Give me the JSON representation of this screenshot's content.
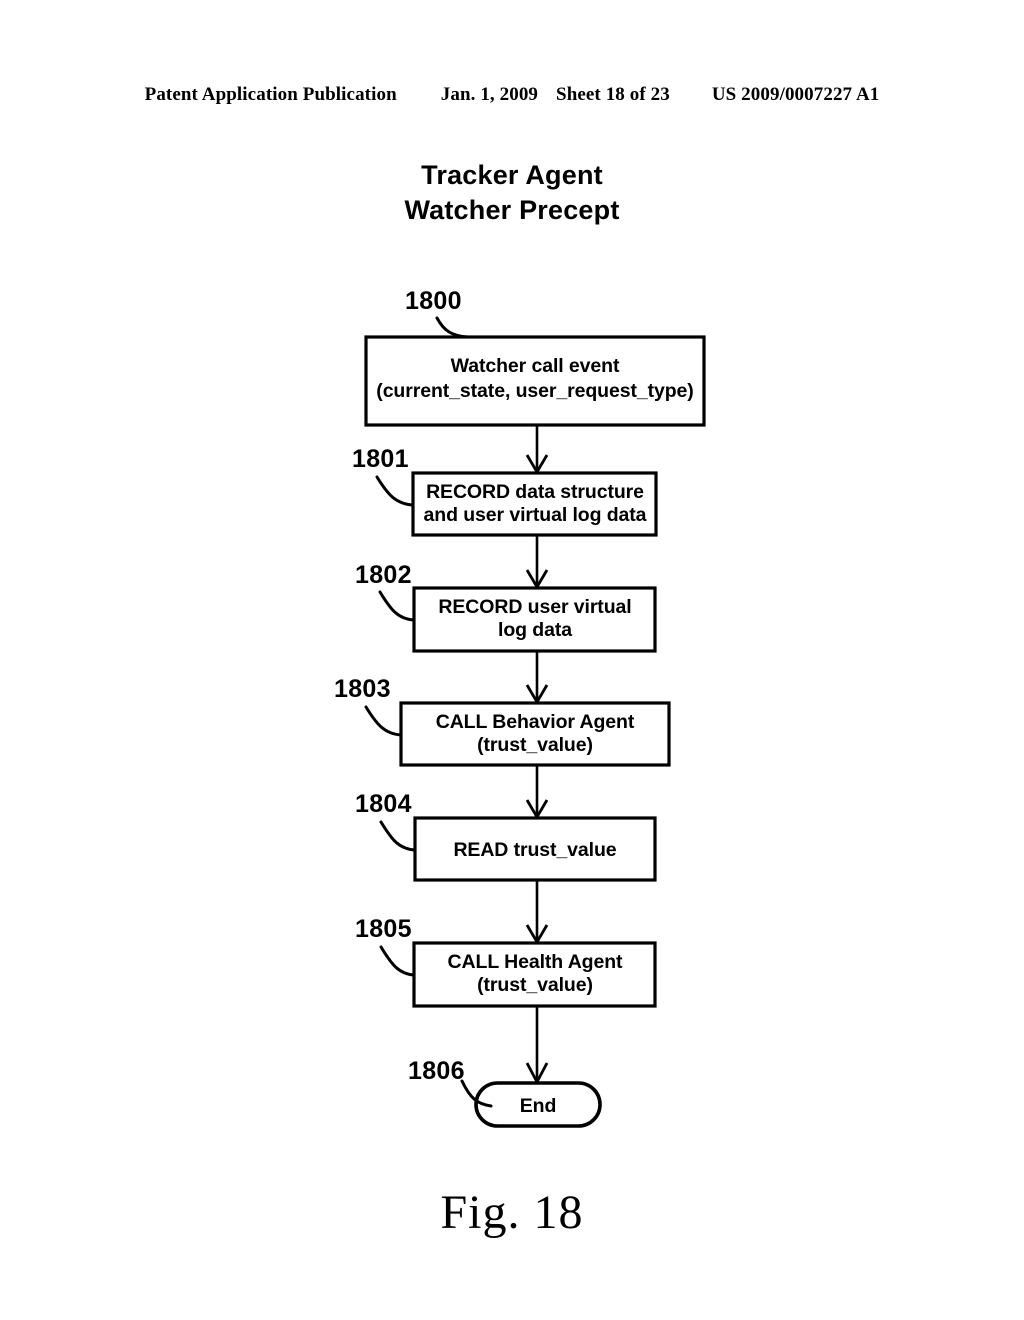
{
  "header": {
    "publication": "Patent Application Publication",
    "date": "Jan. 1, 2009",
    "sheet": "Sheet 18 of 23",
    "patent_number": "US 2009/0007227 A1"
  },
  "diagram": {
    "title_line1": "Tracker Agent",
    "title_line2": "Watcher Precept",
    "caption": "Fig. 18"
  },
  "flowchart": {
    "type": "flowchart",
    "orientation": "top-to-bottom",
    "nodes": [
      {
        "ref": "1800",
        "shape": "rectangle",
        "line1": "Watcher call event",
        "line2": "(current_state, user_request_type)"
      },
      {
        "ref": "1801",
        "shape": "rectangle",
        "line1": "RECORD data structure",
        "line2": "and user virtual log data"
      },
      {
        "ref": "1802",
        "shape": "rectangle",
        "line1": "RECORD user virtual",
        "line2": "log data"
      },
      {
        "ref": "1803",
        "shape": "rectangle",
        "line1": "CALL Behavior Agent",
        "line2": "(trust_value)"
      },
      {
        "ref": "1804",
        "shape": "rectangle",
        "line1": "READ trust_value",
        "line2": ""
      },
      {
        "ref": "1805",
        "shape": "rectangle",
        "line1": "CALL Health Agent",
        "line2": "(trust_value)"
      },
      {
        "ref": "1806",
        "shape": "stadium",
        "line1": "End",
        "line2": ""
      }
    ]
  }
}
